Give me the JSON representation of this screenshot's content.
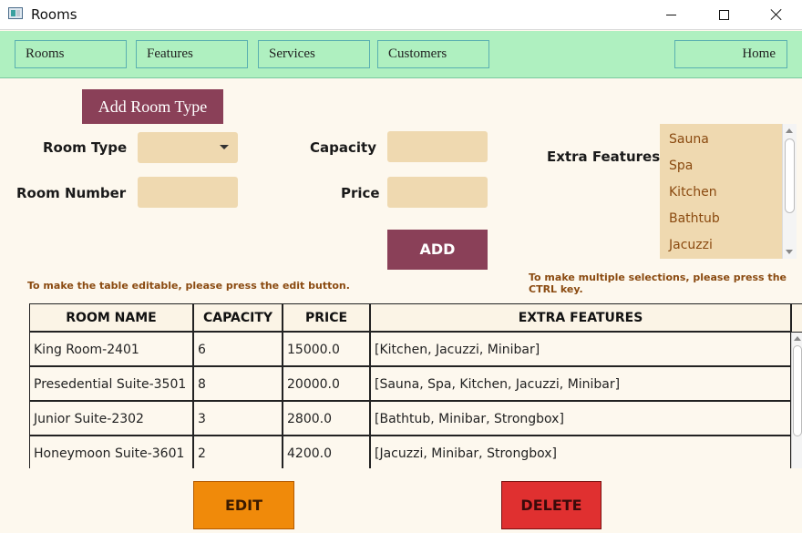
{
  "window": {
    "title": "Rooms",
    "icons": {
      "app": "app-window-icon",
      "minimize": "minimize-icon",
      "maximize": "maximize-icon",
      "close": "close-icon"
    }
  },
  "nav": {
    "rooms": "Rooms",
    "features": "Features",
    "services": "Services",
    "customers": "Customers",
    "home": "Home"
  },
  "form": {
    "add_room_type_label": "Add Room Type",
    "room_type_label": "Room Type",
    "room_type_value": "",
    "room_number_label": "Room Number",
    "room_number_value": "",
    "capacity_label": "Capacity",
    "capacity_value": "",
    "price_label": "Price",
    "price_value": "",
    "extra_features_label": "Extra Features",
    "extra_features_options": [
      "Sauna",
      "Spa",
      "Kitchen",
      "Bathtub",
      "Jacuzzi"
    ],
    "add_label": "ADD"
  },
  "hints": {
    "edit": "To make the table editable, please press the edit button.",
    "multi_select": "To make multiple selections, please press the CTRL key."
  },
  "table": {
    "columns": [
      "ROOM NAME",
      "CAPACITY",
      "PRICE",
      "EXTRA FEATURES"
    ],
    "rows": [
      [
        "King Room-2401",
        "6",
        "15000.0",
        "[Kitchen, Jacuzzi, Minibar]"
      ],
      [
        "Presedential Suite-3501",
        "8",
        "20000.0",
        "[Sauna, Spa, Kitchen, Jacuzzi, Minibar]"
      ],
      [
        "Junior Suite-2302",
        "3",
        "2800.0",
        "[Bathtub, Minibar, Strongbox]"
      ],
      [
        "Honeymoon Suite-3601",
        "2",
        "4200.0",
        "[Jacuzzi, Minibar, Strongbox]"
      ]
    ]
  },
  "actions": {
    "edit_label": "EDIT",
    "delete_label": "DELETE"
  },
  "colors": {
    "navbar": "#aff0c0",
    "accent": "#8a4058",
    "field": "#efd9b0",
    "edit": "#f08a0a",
    "delete": "#e03030",
    "background": "#fdf8ee"
  }
}
